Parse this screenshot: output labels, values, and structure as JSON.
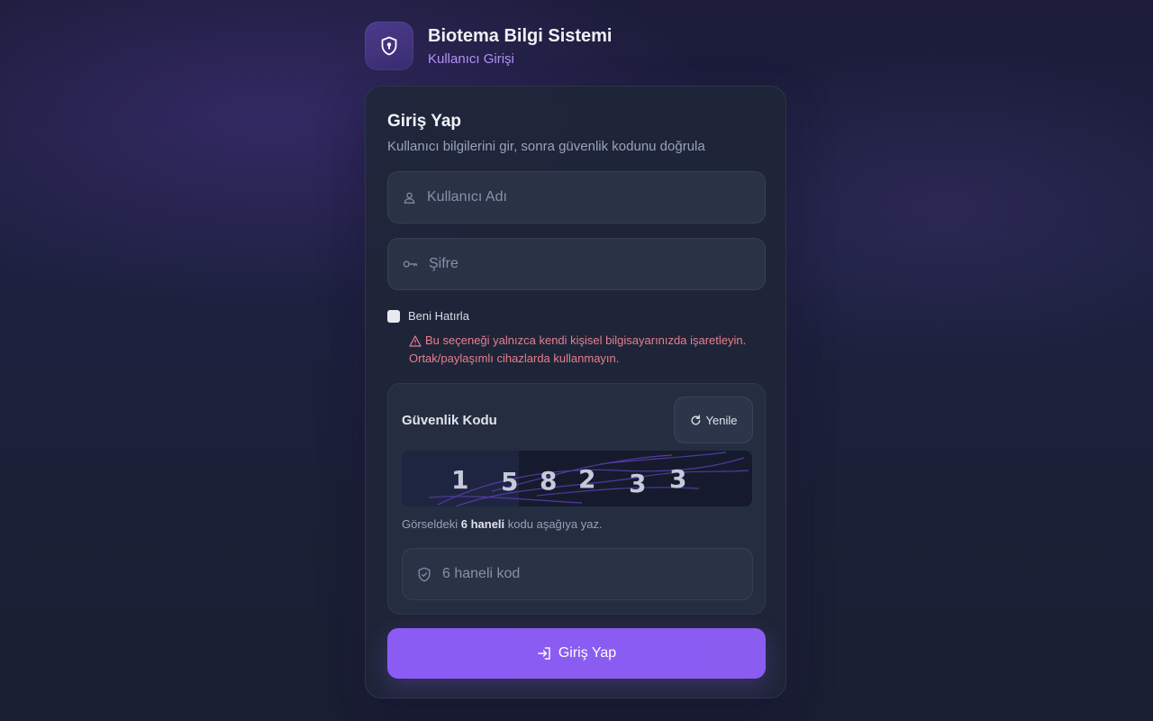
{
  "app": {
    "title": "Biotema Bilgi Sistemi",
    "subtitle": "Kullanıcı Girişi",
    "logo_icon": "shield-lock-icon"
  },
  "form": {
    "title": "Giriş Yap",
    "subtitle": "Kullanıcı bilgilerini gir, sonra güvenlik kodunu doğrula",
    "username": {
      "placeholder": "Kullanıcı Adı",
      "value": "",
      "icon": "user-icon"
    },
    "password": {
      "placeholder": "Şifre",
      "value": "",
      "icon": "key-icon"
    },
    "remember": {
      "label": "Beni Hatırla",
      "checked": false,
      "warning_line1": "Bu seçeneği yalnızca kendi kişisel bilgisayarınızda işaretleyin.",
      "warning_line2": "Ortak/paylaşımlı cihazlarda kullanmayın.",
      "warning_icon": "warning-icon"
    },
    "captcha": {
      "title": "Güvenlik Kodu",
      "refresh_label": "Yenile",
      "refresh_icon": "refresh-icon",
      "digits": [
        "1",
        "5",
        "8",
        "2",
        "3",
        "3"
      ],
      "hint_before": "Görseldeki ",
      "hint_bold": "6 haneli",
      "hint_after": " kodu aşağıya yaz.",
      "input": {
        "placeholder": "6 haneli kod",
        "value": "",
        "icon": "shield-check-icon"
      }
    },
    "submit_label": "Giriş Yap",
    "submit_icon": "login-icon"
  },
  "colors": {
    "accent": "#8a5cf4",
    "subtitle_accent": "#b693f5",
    "warning": "#e87e8e"
  }
}
